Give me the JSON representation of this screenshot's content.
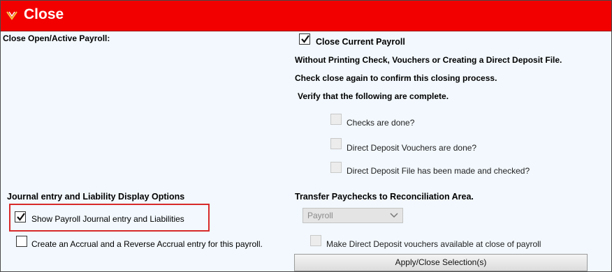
{
  "window": {
    "title": "Close"
  },
  "left": {
    "close_heading": "Close Open/Active Payroll:",
    "journal_heading": "Journal entry and Liability Display Options",
    "show_journal": {
      "label": "Show Payroll Journal entry and Liabilities",
      "checked": true
    },
    "accrual": {
      "label": "Create an Accrual and a Reverse Accrual entry for this payroll.",
      "checked": false
    }
  },
  "right": {
    "close_current": {
      "label": "Close Current Payroll",
      "checked": true
    },
    "note_line1": "Without Printing Check, Vouchers or Creating a Direct Deposit File.",
    "note_line2": "Check close again to confirm this closing process.",
    "verify_heading": "Verify that the following are complete.",
    "checks": [
      {
        "label": "Checks are done?",
        "checked": false,
        "enabled": false
      },
      {
        "label": "Direct Deposit Vouchers are done?",
        "checked": false,
        "enabled": false
      },
      {
        "label": "Direct Deposit File has been made and checked?",
        "checked": false,
        "enabled": false
      }
    ],
    "transfer_heading": "Transfer Paychecks to Reconciliation Area.",
    "transfer_select": {
      "value": "Payroll"
    },
    "make_vouchers": {
      "label": "Make Direct Deposit vouchers available at close of payroll",
      "checked": false,
      "enabled": false
    },
    "apply_button": "Apply/Close Selection(s)"
  },
  "colors": {
    "titlebar": "#f20000",
    "background": "#f2f8fd",
    "highlight": "#d82a2a"
  }
}
